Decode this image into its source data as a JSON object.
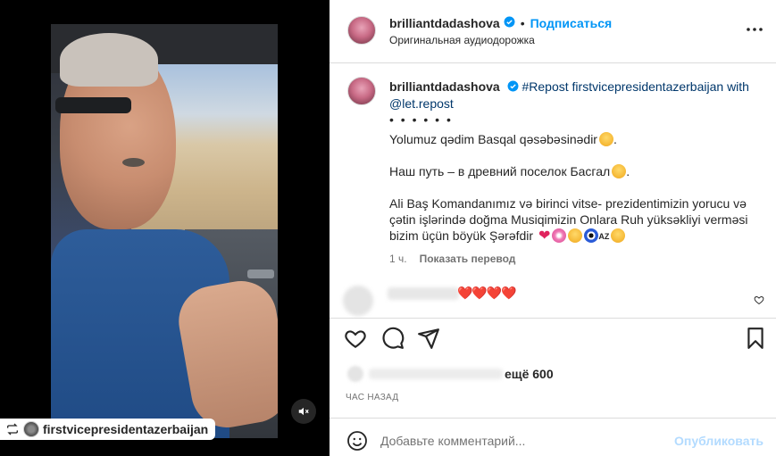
{
  "media": {
    "repost_tag": "firstvicepresidentazerbaijan",
    "mute_icon": "speaker-muted-icon"
  },
  "post": {
    "username": "brilliantdadashova",
    "follow_label": "Подписаться",
    "dot": "•",
    "audio_label": "Оригинальная аудиодорожка"
  },
  "caption": {
    "username": "brilliantdadashova",
    "hashtag": "#Repost",
    "source": "firstvicepresidentazerbaijan",
    "with_word": "with",
    "mention": "@let.repost",
    "dots": "• • • • • •",
    "line1": "Yolumuz qədim Basqal qəsəbəsinədir",
    "line2": "Наш путь – в древний поселок Басгал",
    "line3": "Ali Baş Komandanımız və birinci vitse- prezidentimizin yorucu və çətin işlərində doğma Musiqimizin Onlara Ruh yüksəkliyi verməsi bizim üçün böyük Şərəfdir",
    "az_label": "AZ",
    "heart": "❤"
  },
  "meta": {
    "time_ago": "1 ч.",
    "translate_label": "Показать перевод"
  },
  "comment": {
    "hearts": "❤️❤️❤️❤️"
  },
  "likes": {
    "count_label": "ещё 600"
  },
  "timestamp": "ЧАС НАЗАД",
  "add_comment": {
    "placeholder": "Добавьте комментарий...",
    "publish_label": "Опубликовать"
  },
  "colors": {
    "accent": "#0095f6",
    "publish_disabled": "#b3dbff",
    "heart": "#e0245e",
    "secondary_text": "#737373"
  }
}
